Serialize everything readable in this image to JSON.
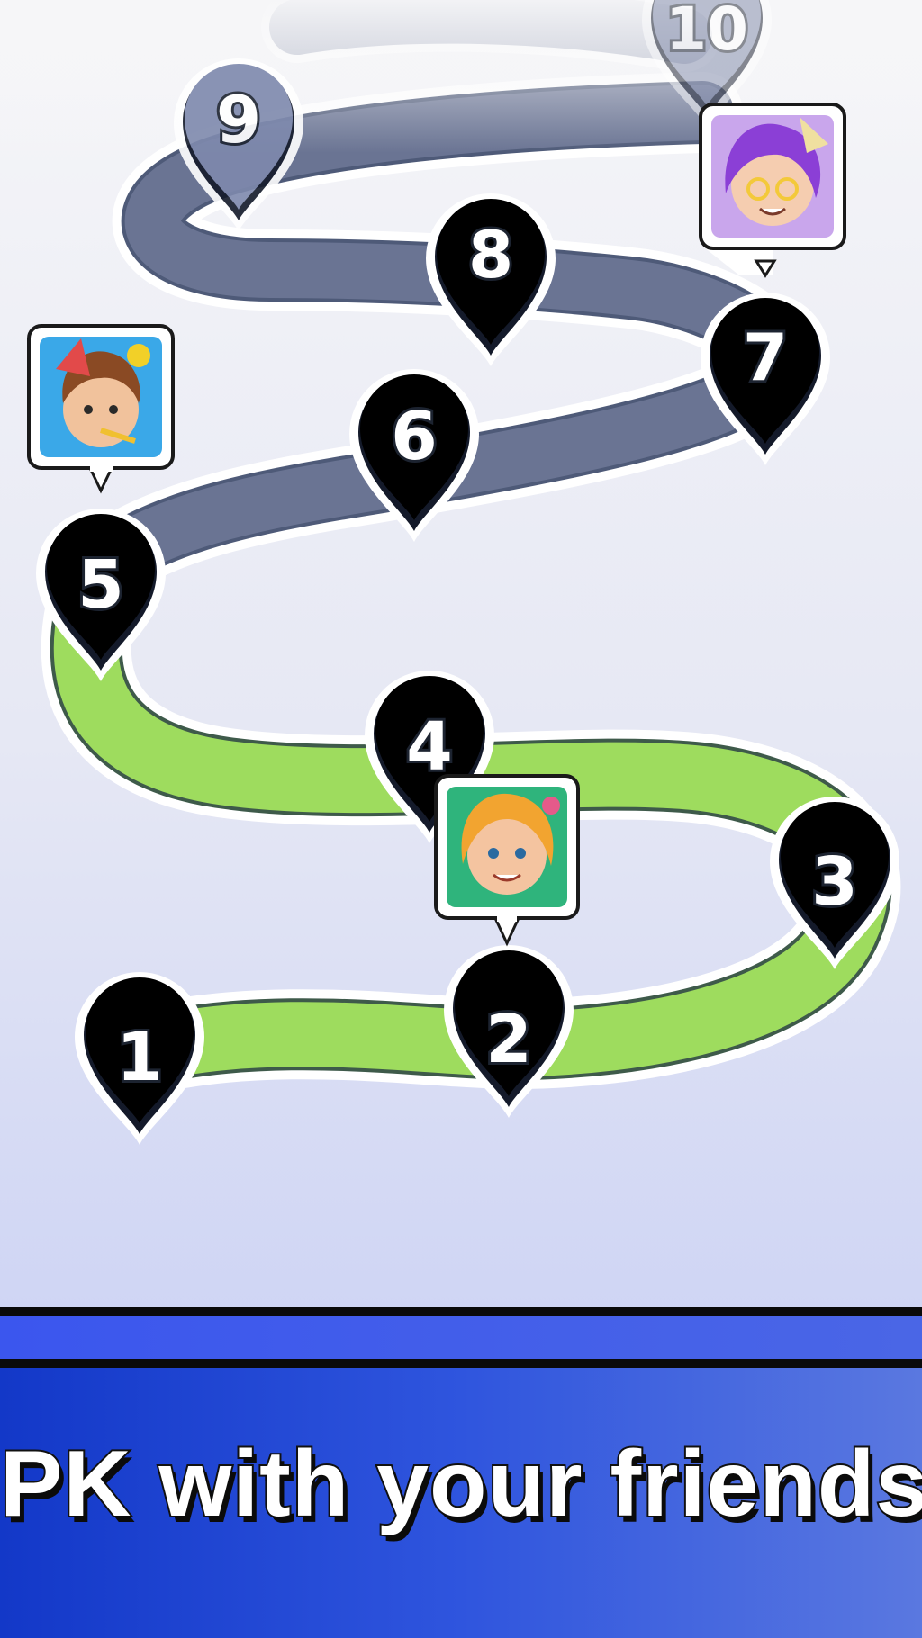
{
  "levels": [
    {
      "number": "1",
      "state": "completed"
    },
    {
      "number": "2",
      "state": "completed"
    },
    {
      "number": "3",
      "state": "completed"
    },
    {
      "number": "4",
      "state": "completed"
    },
    {
      "number": "5",
      "state": "current"
    },
    {
      "number": "6",
      "state": "locked"
    },
    {
      "number": "7",
      "state": "locked"
    },
    {
      "number": "8",
      "state": "locked"
    },
    {
      "number": "9",
      "state": "locked"
    },
    {
      "number": "10",
      "state": "locked"
    }
  ],
  "friends": [
    {
      "name": "boy-friend-avatar",
      "at_level": "5"
    },
    {
      "name": "girl-friend-avatar",
      "at_level": "2"
    },
    {
      "name": "purple-hair-friend-avatar",
      "at_level": "7"
    }
  ],
  "colors": {
    "completed_path": "#9edc5e",
    "locked_path": "#6a7493",
    "completed_pin": "#7cc420",
    "locked_pin": "#6b78a2",
    "banner_blue": "#2a4ed8"
  },
  "banner": {
    "tagline": "PK with your friends"
  }
}
